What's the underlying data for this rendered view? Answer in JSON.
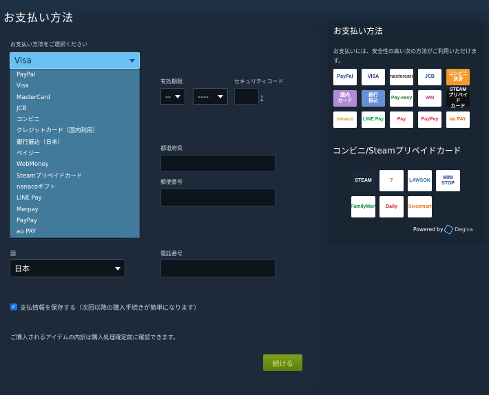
{
  "page": {
    "title": "お支払い方法"
  },
  "form": {
    "method_label": "お支払い方法をご選択ください",
    "method_selected": "Visa",
    "method_options": [
      "PayPal",
      "Visa",
      "MasterCard",
      "JCB",
      "コンビニ",
      "クレジットカード（国内利用）",
      "銀行振込（日本）",
      "ペイジー",
      "WebMoney",
      "Steamプリペイドカード",
      "nanacoギフト",
      "LINE Pay",
      "Merpay",
      "PayPay",
      "au PAY"
    ],
    "expiry_label": "有効期限",
    "expiry_month": "--",
    "expiry_year": "----",
    "security_label": "セキュリティコード",
    "security_help": "?",
    "prefecture_label": "都道府県",
    "postal_label": "郵便番号",
    "country_label": "国",
    "country_value": "日本",
    "phone_label": "電話番号",
    "save_label": "支払情報を保存する（次回以降の購入手続きが簡単になります）",
    "note": "ご購入されるアイテムの内訳は購入処理確定前に確認できます。",
    "continue_label": "続ける"
  },
  "side": {
    "title": "お支払い方法",
    "description": "お支払いには、安全性の高い次の方法がご利用いただけます。",
    "logos": [
      {
        "name": "paypal",
        "text": "PayPal",
        "bg": "#ffffff",
        "fg": "#1a3d8f"
      },
      {
        "name": "visa",
        "text": "VISA",
        "bg": "#ffffff",
        "fg": "#1a1f71"
      },
      {
        "name": "mastercard",
        "text": "mastercard",
        "bg": "#ffffff",
        "fg": "#333333"
      },
      {
        "name": "jcb",
        "text": "JCB",
        "bg": "#ffffff",
        "fg": "#0b4ea2"
      },
      {
        "name": "konbini",
        "text": "コンビニ\n決済",
        "bg": "#f39a2e",
        "fg": "#ffffff"
      },
      {
        "name": "domestic-card",
        "text": "国内\nカード",
        "bg": "#b38ad6",
        "fg": "#ffffff"
      },
      {
        "name": "bank-transfer",
        "text": "銀行\n振込",
        "bg": "#6a8fd6",
        "fg": "#ffffff"
      },
      {
        "name": "payeasy",
        "text": "Pay-easy",
        "bg": "#ffffff",
        "fg": "#2a7a3a"
      },
      {
        "name": "webmoney",
        "text": "WM",
        "bg": "#ffffff",
        "fg": "#c23a8a"
      },
      {
        "name": "steam-prepaid",
        "text": "STEAM\nプリペイド\nカード",
        "bg": "#111111",
        "fg": "#ffffff"
      },
      {
        "name": "nanaco",
        "text": "nanaco",
        "bg": "#ffffff",
        "fg": "#d4a21a"
      },
      {
        "name": "linepay",
        "text": "LINE Pay",
        "bg": "#ffffff",
        "fg": "#00a33c"
      },
      {
        "name": "merpay",
        "text": "Pay",
        "bg": "#ffffff",
        "fg": "#e0233c"
      },
      {
        "name": "paypay",
        "text": "PayPay",
        "bg": "#ffffff",
        "fg": "#e0233c"
      },
      {
        "name": "aupay",
        "text": "au PAY",
        "bg": "#ffffff",
        "fg": "#eb6100"
      }
    ],
    "convenience_title": "コンビニ/Steamプリペイドカード",
    "stores": [
      {
        "name": "steam-store",
        "text": "STEAM",
        "bg": "#1b2838",
        "fg": "#ffffff"
      },
      {
        "name": "seven-eleven",
        "text": "7",
        "bg": "#ffffff",
        "fg": "#e05a1a"
      },
      {
        "name": "lawson",
        "text": "LAWSON",
        "bg": "#ffffff",
        "fg": "#2d6bb5"
      },
      {
        "name": "ministop",
        "text": "MINI\nSTOP",
        "bg": "#ffffff",
        "fg": "#1c3f8f"
      },
      {
        "name": "familymart",
        "text": "FamilyMart",
        "bg": "#ffffff",
        "fg": "#0a8a4a"
      },
      {
        "name": "daily-yamazaki",
        "text": "Daily",
        "bg": "#ffffff",
        "fg": "#d8241c"
      },
      {
        "name": "seicomart",
        "text": "Seicomart",
        "bg": "#ffffff",
        "fg": "#e07a1a"
      }
    ],
    "powered_by": "Powered by",
    "powered_brand": "Degica"
  }
}
